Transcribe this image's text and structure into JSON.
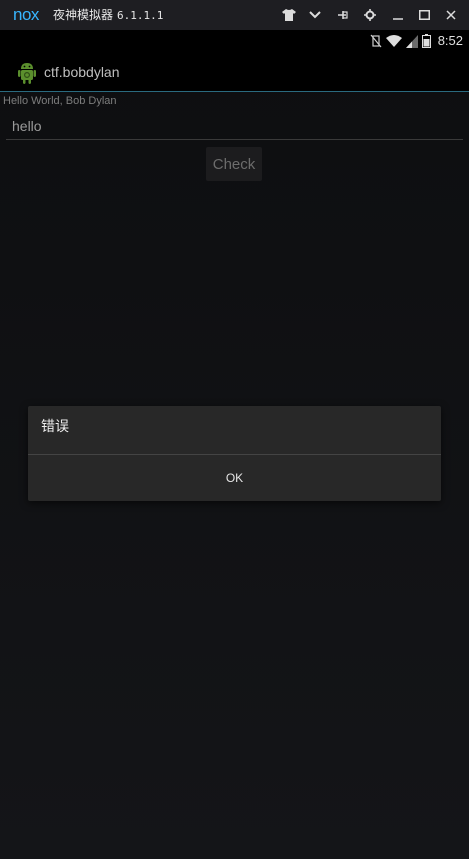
{
  "emulator": {
    "logo": "nox",
    "title": "夜神模拟器",
    "version": "6.1.1.1",
    "accent": "#38b6ff",
    "buttons": [
      "shirt-icon",
      "chevron-down-icon",
      "pin-icon",
      "gear-icon",
      "minimize-icon",
      "maximize-icon",
      "close-icon"
    ]
  },
  "statusbar": {
    "time": "8:52"
  },
  "actionbar": {
    "app_title": "ctf.bobdylan"
  },
  "main": {
    "hello_text": "Hello World, Bob Dylan",
    "input_value": "hello",
    "check_label": "Check"
  },
  "dialog": {
    "title": "错误",
    "ok_label": "OK"
  }
}
